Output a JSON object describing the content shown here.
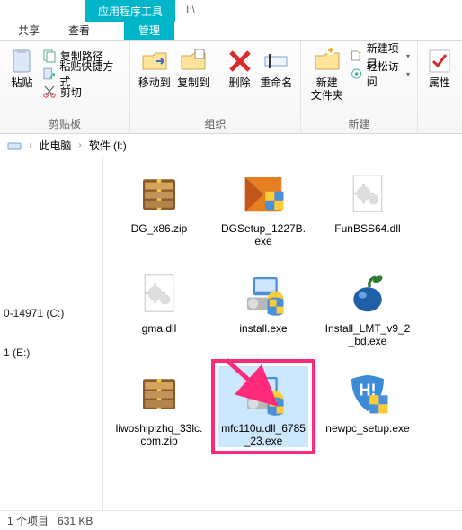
{
  "titlebar": {
    "tool_tab": "应用程序工具",
    "drive": "I:\\"
  },
  "tabs": {
    "share": "共享",
    "view": "查看",
    "manage": "管理"
  },
  "ribbon": {
    "clipboard": {
      "paste": "粘贴",
      "copy_path": "复制路径",
      "paste_shortcut": "粘贴快捷方式",
      "cut": "剪切",
      "group": "剪贴板"
    },
    "organize": {
      "move_to": "移动到",
      "copy_to": "复制到",
      "delete": "删除",
      "rename": "重命名",
      "group": "组织"
    },
    "new": {
      "new_folder": "新建\n文件夹",
      "new_item": "新建项目",
      "easy_access": "轻松访问",
      "group": "新建"
    },
    "props": {
      "properties": "属性"
    }
  },
  "crumbs": {
    "pc": "此电脑",
    "drive": "软件 (I:)"
  },
  "side": {
    "drive_c": "0-14971 (C:)",
    "drive_e": "1 (E:)"
  },
  "files": [
    {
      "name": "DG_x86.zip",
      "type": "zip"
    },
    {
      "name": "DGSetup_1227B.exe",
      "type": "setup-orange"
    },
    {
      "name": "FunBSS64.dll",
      "type": "dll"
    },
    {
      "name": "gma.dll",
      "type": "dll"
    },
    {
      "name": "install.exe",
      "type": "installer"
    },
    {
      "name": "Install_LMT_v9_2_bd.exe",
      "type": "fruit"
    },
    {
      "name": "liwoshipizhq_33lc.com.zip",
      "type": "zip"
    },
    {
      "name": "mfc110u.dll_6785_23.exe",
      "type": "installer",
      "selected": true
    },
    {
      "name": "newpc_setup.exe",
      "type": "shield-h"
    }
  ],
  "status": {
    "selected": "1 个项目",
    "size": "631 KB"
  }
}
